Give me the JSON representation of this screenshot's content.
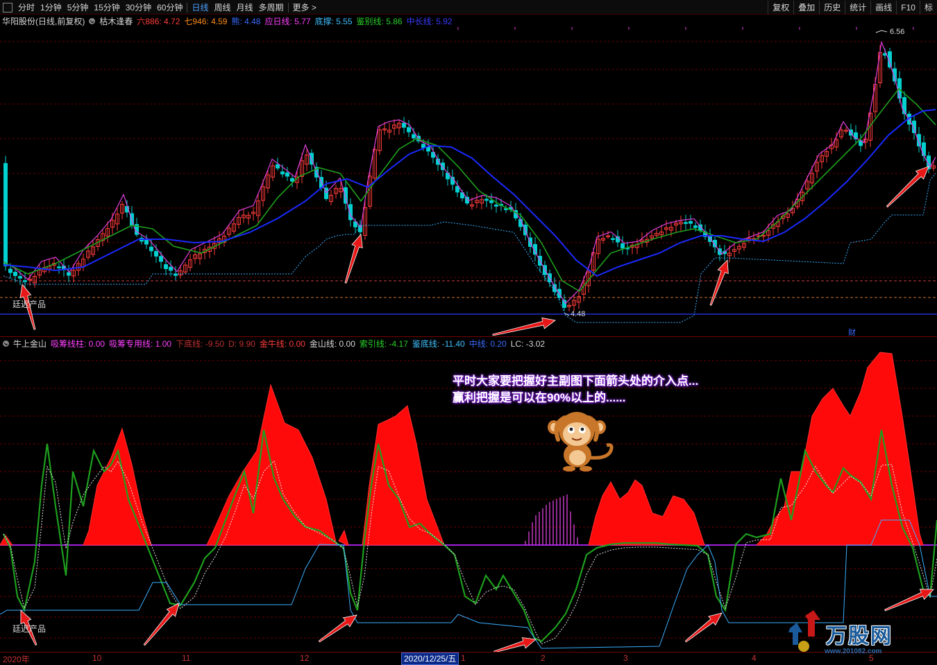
{
  "toolbar": {
    "periods": [
      "分时",
      "1分钟",
      "5分钟",
      "15分钟",
      "30分钟",
      "60分钟",
      "日线",
      "周线",
      "月线",
      "多周期",
      "更多 >"
    ],
    "active_period": "日线",
    "buttons": [
      "复权",
      "叠加",
      "历史",
      "统计",
      "画线",
      "F10",
      "标"
    ]
  },
  "main_panel": {
    "stock": "华阳股份(日线,前复权)",
    "indicator": "枯木逢春",
    "fields": [
      {
        "label": "六886:",
        "value": "4.72",
        "color": "#ff3c3c"
      },
      {
        "label": "七946:",
        "value": "4.59",
        "color": "#ff8c1a"
      },
      {
        "label": "熊:",
        "value": "4.48",
        "color": "#3a6aff"
      },
      {
        "label": "应日线:",
        "value": "5.77",
        "color": "#ff40ff"
      },
      {
        "label": "底撑:",
        "value": "5.55",
        "color": "#40c0ff"
      },
      {
        "label": "鉴别线:",
        "value": "5.86",
        "color": "#2ad02a"
      },
      {
        "label": "中长线:",
        "value": "5.92",
        "color": "#3a3aff"
      }
    ],
    "high_label": "6.56",
    "low_label": "4.48",
    "watermark": "廷迟产品",
    "cai_label": "财"
  },
  "sub_panel": {
    "indicator": "牛上金山",
    "fields": [
      {
        "label": "吸筹线柱:",
        "value": "0.00",
        "color": "#ff40ff"
      },
      {
        "label": "吸筹专用线:",
        "value": "1.00",
        "color": "#ff40ff"
      },
      {
        "label": "下底线:",
        "value": "-9.50",
        "color": "#c03030"
      },
      {
        "label": "D:",
        "value": "9.90",
        "color": "#c03030"
      },
      {
        "label": "金牛线:",
        "value": "0.00",
        "color": "#ff3c3c"
      },
      {
        "label": "金山线:",
        "value": "0.00",
        "color": "#d8d8d8"
      },
      {
        "label": "索引线:",
        "value": "-4.17",
        "color": "#2ad02a"
      },
      {
        "label": "鉴底线:",
        "value": "-11.40",
        "color": "#40c0ff"
      },
      {
        "label": "中线:",
        "value": "0.20",
        "color": "#3a6aff"
      },
      {
        "label": "LC:",
        "value": "-3.02",
        "color": "#d8d8d8"
      }
    ],
    "watermark": "廷迟产品"
  },
  "callout": {
    "line1": "平时大家要把握好主副图下面箭头处的介入点...",
    "line2": "赢利把握是可以在90%以上的......"
  },
  "x_axis": {
    "labels": [
      "2020年",
      "10",
      "11",
      "12",
      "1",
      "2",
      "3",
      "4",
      "5"
    ],
    "cursor_date": "2020/12/25/五"
  },
  "logo": {
    "name": "万股网",
    "url": "www.201082.com"
  },
  "colors": {
    "up": "#ff3c3c",
    "down": "#00d0d0",
    "green_line": "#1ea01e",
    "blue_line": "#1a2aff",
    "magenta_line": "#e040e0",
    "support": "#3ab0ff",
    "arrow": "#e81818"
  },
  "chart_data": {
    "type": "line",
    "series": [
      {
        "name": "鉴别线",
        "values": [
          5.2,
          5.1,
          5.0,
          5.3,
          5.5,
          5.7,
          5.6,
          5.3,
          5.2,
          5.6,
          5.8,
          5.7,
          5.9,
          5.7,
          5.5,
          5.9,
          6.3,
          6.1,
          5.9,
          5.6,
          5.2,
          4.8,
          4.6,
          5.1,
          5.3,
          5.4,
          5.3,
          5.2,
          5.3,
          5.6,
          5.9,
          6.2,
          6.0,
          5.9
        ]
      },
      {
        "name": "中长线",
        "values": [
          5.2,
          5.15,
          5.1,
          5.2,
          5.3,
          5.4,
          5.45,
          5.4,
          5.35,
          5.45,
          5.6,
          5.65,
          5.7,
          5.72,
          5.65,
          5.75,
          5.95,
          6.0,
          5.95,
          5.8,
          5.6,
          5.35,
          5.1,
          5.0,
          5.05,
          5.15,
          5.2,
          5.2,
          5.25,
          5.45,
          5.6,
          5.8,
          5.9,
          5.92
        ]
      }
    ]
  }
}
